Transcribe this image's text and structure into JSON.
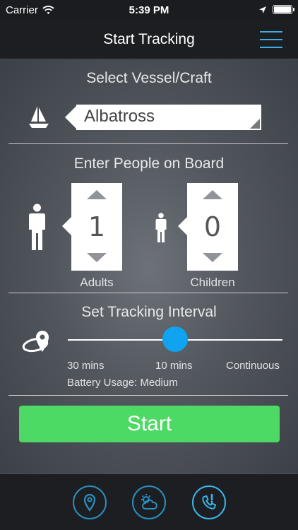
{
  "status_bar": {
    "carrier": "Carrier",
    "time": "5:39 PM"
  },
  "nav": {
    "title": "Start Tracking",
    "menu_icon": "hamburger-menu-icon"
  },
  "vessel": {
    "section_title": "Select Vessel/Craft",
    "icon": "sailboat-icon",
    "selected": "Albatross"
  },
  "people": {
    "section_title": "Enter People on Board",
    "adults": {
      "value": "1",
      "label": "Adults",
      "icon": "adult-person-icon"
    },
    "children": {
      "value": "0",
      "label": "Children",
      "icon": "child-person-icon"
    }
  },
  "tracking": {
    "section_title": "Set Tracking Interval",
    "icon": "location-orbit-icon",
    "options": [
      "30 mins",
      "10 mins",
      "Continuous"
    ],
    "selected_index": 1,
    "battery_usage": "Battery Usage: Medium"
  },
  "start_label": "Start",
  "tabs": [
    {
      "name": "location-pin-icon"
    },
    {
      "name": "weather-icon"
    },
    {
      "name": "emergency-phone-icon",
      "active": true
    }
  ],
  "colors": {
    "accent": "#3ab0e0",
    "start_green": "#4cd964",
    "slider_thumb": "#0fa3f0"
  }
}
